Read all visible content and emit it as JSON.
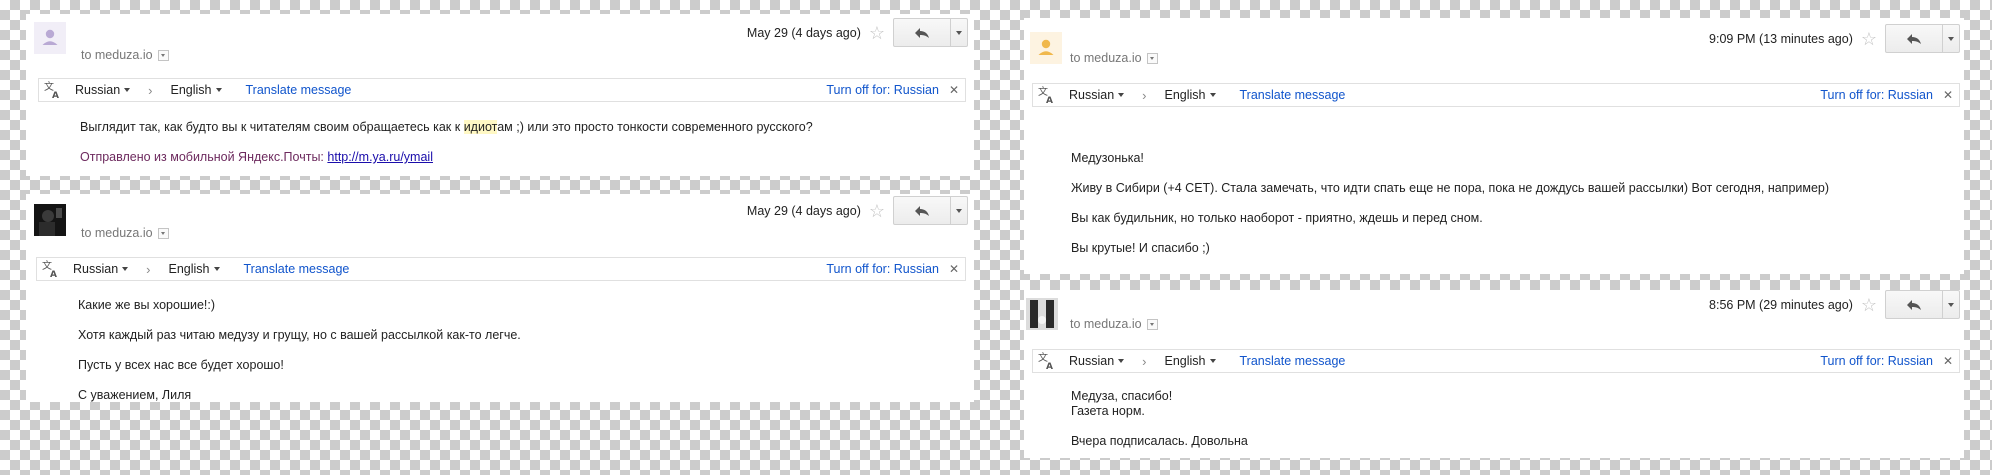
{
  "common": {
    "to_label": "to meduza.io",
    "from_lang": "Russian",
    "to_lang": "English",
    "lang_separator": "›",
    "translate_label": "Translate message",
    "turn_off_label": "Turn off for: Russian",
    "close_glyph": "✕",
    "star_glyph": "☆",
    "colors": {
      "link": "#1155cc",
      "signature": "#6d2a5e",
      "highlight": "#fff8c4",
      "checker": "#cccccc"
    },
    "icons": [
      "translate-icon",
      "reply-icon",
      "star-icon",
      "chevron-down-icon",
      "close-icon"
    ]
  },
  "emails": [
    {
      "date": "May 29 (4 days ago)",
      "body_pre": "Выглядит так, как будто вы к читателям своим обращаетесь как к ",
      "body_highlight": "идиот",
      "body_post": "ам ;) или это просто тонкости современного русского?",
      "signature_text": "Отправлено из мобильной Яндекс.Почты: ",
      "signature_link": "http://m.ya.ru/ymail"
    },
    {
      "date": "May 29 (4 days ago)",
      "paragraphs": [
        "Какие же вы хорошие!:)",
        "Хотя каждый раз читаю медузу и грущу, но с вашей рассылкой как-то легче.",
        "Пусть у всех нас все будет хорошо!",
        "С уважением, Лиля"
      ]
    },
    {
      "date": "9:09 PM (13 minutes ago)",
      "paragraphs": [
        "Медузонька!",
        "Живу в Сибири (+4 CET). Стала замечать, что идти спать еще не пора, пока не дождусь вашей рассылки) Вот сегодня, например)",
        "Вы как будильник, но только наоборот - приятно, ждешь и перед сном.",
        "Вы крутые! И спасибо ;)"
      ]
    },
    {
      "date": "8:56 PM (29 minutes ago)",
      "line1": "Медуза, спасибо!",
      "line2": "Газета норм.",
      "line3": "Вчера подписалась. Довольна"
    }
  ]
}
